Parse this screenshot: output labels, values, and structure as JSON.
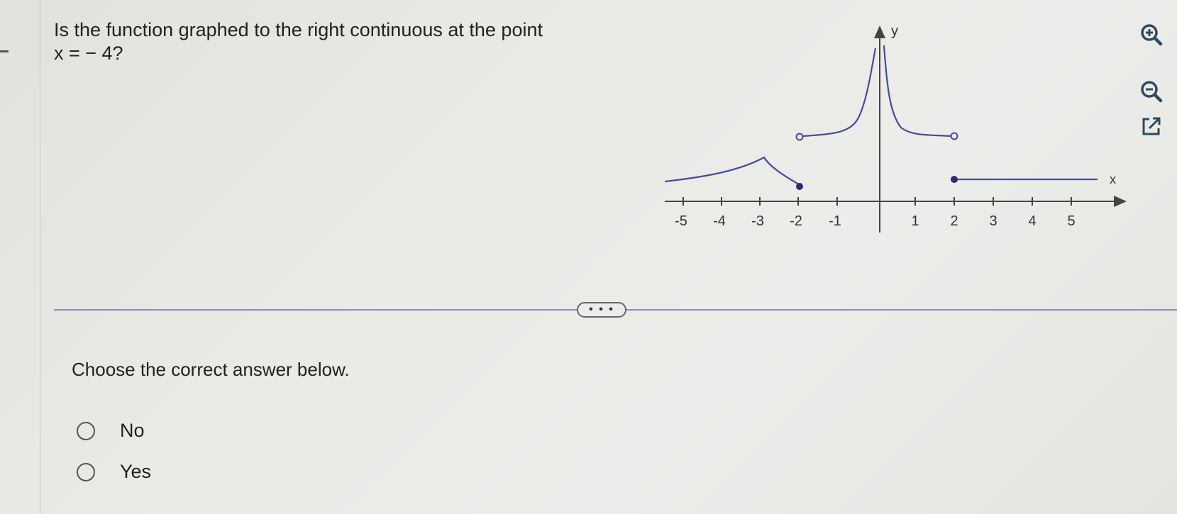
{
  "question": {
    "line1": "Is the function graphed to the right continuous at the point",
    "line2": "x = − 4?"
  },
  "graph": {
    "x_axis_label": "x",
    "y_axis_label": "y",
    "x_ticks": [
      "-5",
      "-4",
      "-3",
      "-2",
      "-1",
      "1",
      "2",
      "3",
      "4",
      "5"
    ],
    "curve_color": "#4a4a9a",
    "axis_color": "#444444"
  },
  "tools": {
    "zoom_in": "zoom-in-icon",
    "zoom_out": "zoom-out-icon",
    "open_new_window": "external-link-icon"
  },
  "more_label": "• • •",
  "instruction": "Choose the correct answer below.",
  "options": [
    {
      "label": "No",
      "selected": false
    },
    {
      "label": "Yes",
      "selected": false
    }
  ]
}
